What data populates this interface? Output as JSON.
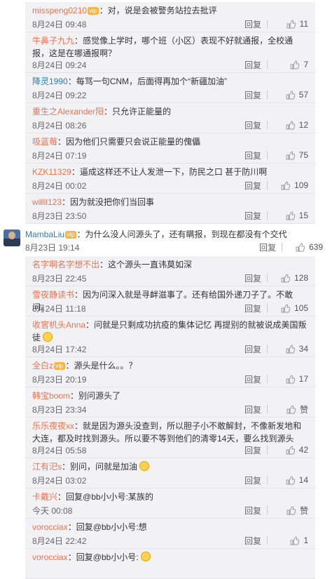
{
  "replies_top": [
    {
      "user": "misspeng0210",
      "vip": "vip",
      "text": "：对，说是会被警务站拉去批评",
      "time": "8月24日 09:48",
      "reply": "回复",
      "likes": "11"
    },
    {
      "user": "牛鼻子九九",
      "text": "：感觉像上学时，哪个班（小区）表现不好就通报，全校通报，这是在哪通报啊？",
      "time": "8月24日 09:24",
      "reply": "回复",
      "likes": "7",
      "tall": true
    },
    {
      "user": "降灵1990",
      "blue": true,
      "text": "：每骂一句CNM，后面得再加个“新疆加油”",
      "time": "8月24日 09:22",
      "reply": "回复",
      "likes": "57"
    },
    {
      "user": "重生之Alexander阳",
      "text": "：只允许正能量的",
      "time": "8月24日 08:26",
      "reply": "回复",
      "likes": "12"
    },
    {
      "user": "吸蓝莓",
      "text": "：因为他们只需要只会说正能量的傀儡",
      "time": "8月24日 07:19",
      "reply": "回复",
      "likes": "75"
    },
    {
      "user": "KZK11329",
      "text": "：逼成这样还不让人发泄一下，防民之口 甚于防川啊",
      "time": "8月24日 00:02",
      "reply": "回复",
      "likes": "109"
    },
    {
      "user": "willll123",
      "text": "：因为就没把你们当回事",
      "time": "8月23日 23:50",
      "reply": "回复",
      "likes": "15"
    }
  ],
  "main_comment": {
    "user": "MambaLiu",
    "vip": "vip",
    "text": "：为什么没人问源头了，还有瞒报，到现在都没有个交代",
    "time": "8月23日 19:14",
    "reply": "回复",
    "likes": "639"
  },
  "replies_bottom": [
    {
      "user": "名字啊名字想不出",
      "text": "：这个源头一直讳莫如深",
      "time": "8月23日 22:45",
      "reply": "回复",
      "likes": "128"
    },
    {
      "user": "雪夜静读书",
      "text": "：因为问深入就是寻衅滋事了。还有给国外递刀子了。不敢问。",
      "time": "8月24日 11:18",
      "reply": "回复",
      "likes": "105"
    },
    {
      "user": "收官机头Anna",
      "text": "：问就是只剩成功抗疫的集体记忆 再提别的就被说成美国叛徒",
      "emoji": true,
      "time": "8月24日 17:42",
      "reply": "回复",
      "likes": "34",
      "tall": true
    },
    {
      "user": "全白z",
      "vip": "vip",
      "text": "：源头是什么。。？",
      "time": "8月23日 20:19",
      "reply": "回复",
      "likes": "17"
    },
    {
      "user": "韩宝boom",
      "text": "：别问源头了",
      "time": "8月23日 23:34",
      "reply": "回复",
      "likes": "赞"
    },
    {
      "user": "乐乐夜夜xx",
      "text": "：就是因为源头没查到，所以胆子小不敢解封，不像新发地和大连，都及时找到源头。所以要不等到他们的清零14天，要么找到源头",
      "time": "8月24日 05:58",
      "reply": "回复",
      "likes": "42",
      "tall": true
    },
    {
      "user": "江有汜s",
      "text": "：别问，问就是加油",
      "emoji": true,
      "time": "8月24日 03:02",
      "reply": "回复",
      "likes": "14"
    },
    {
      "user": "卡戴兴",
      "text": "：回复@bb小小号:某族的",
      "time": "今天 00:08",
      "reply": "回复",
      "likes": "赞"
    },
    {
      "user": "vorocciax",
      "text": "：回复@bb小小号:想",
      "time": "8月24日 22:42",
      "reply": "回复",
      "likes": "1"
    },
    {
      "user": "vorocciax",
      "text": "：回复@bb小小号:",
      "emoji": true,
      "time": "",
      "reply": "",
      "likes": ""
    }
  ]
}
